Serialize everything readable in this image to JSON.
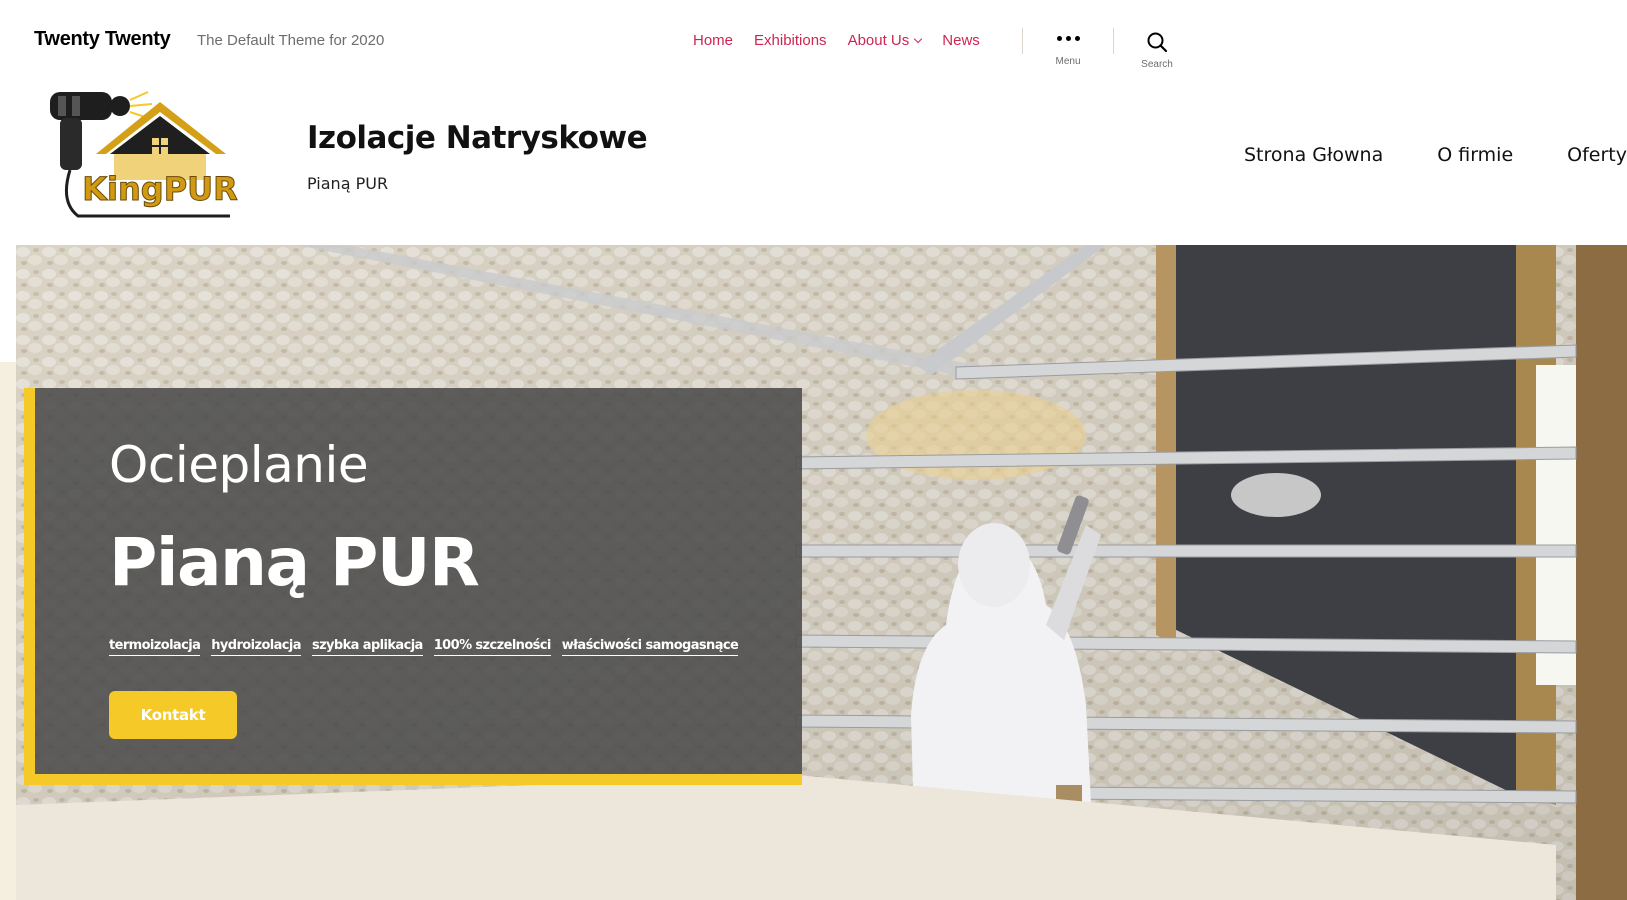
{
  "theme_header": {
    "site_title": "Twenty Twenty",
    "tagline": "The Default Theme for 2020",
    "nav": [
      "Home",
      "Exhibitions",
      "About Us",
      "News"
    ],
    "menu_label": "Menu",
    "search_label": "Search",
    "accent_color": "#cd2653"
  },
  "brand": {
    "logo_text": "KingPUR",
    "site_name": "Izolacje Natryskowe",
    "site_sub": "Pianą PUR",
    "nav": [
      "Strona Głowna",
      "O firmie",
      "Oferty"
    ]
  },
  "hero": {
    "title_line1": "Ocieplanie",
    "title_line2": "Pianą PUR",
    "tags": [
      "termoizolacja",
      "hydroizolacja",
      "szybka aplikacja",
      "100% szczelności",
      "właściwości samogasnące"
    ],
    "cta": "Kontakt",
    "accent_color": "#f4c928"
  }
}
